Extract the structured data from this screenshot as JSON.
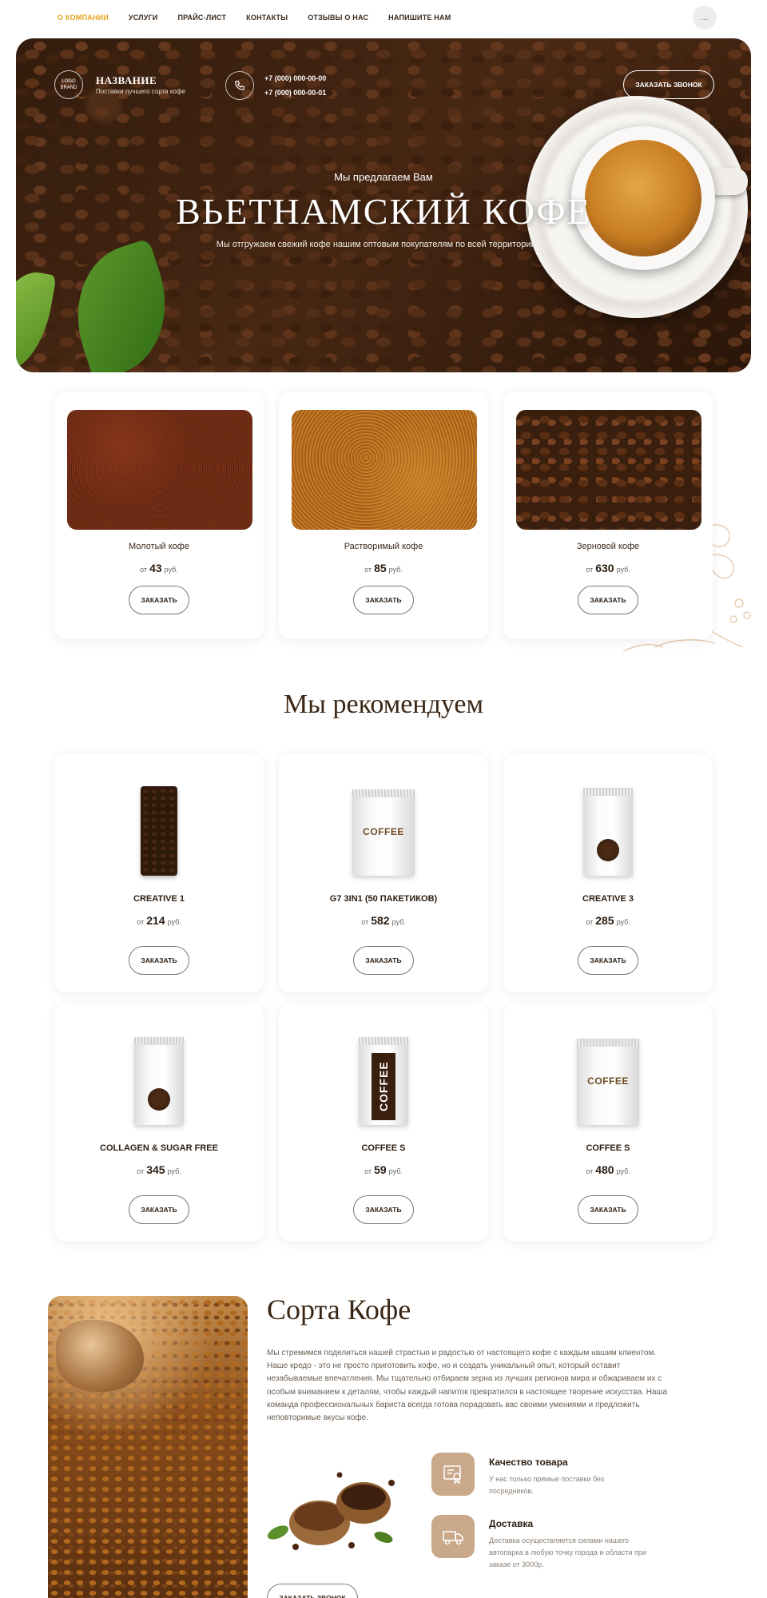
{
  "nav": {
    "links": [
      "О КОМПАНИИ",
      "УСЛУГИ",
      "ПРАЙС-ЛИСТ",
      "КОНТАКТЫ",
      "ОТЗЫВЫ О НАС",
      "НАПИШИТЕ НАМ"
    ],
    "more": "...",
    "accent_color": "#e6a21a"
  },
  "hero": {
    "logo_text": "LOGO BRAND",
    "brand_name": "НАЗВАНИЕ",
    "brand_sub": "Поставки лучшего сорта кофе",
    "phone1": "+7 (000) 000-00-00",
    "phone2": "+7 (000) 000-00-01",
    "callback_button": "ЗАКАЗАТЬ ЗВОНОК",
    "pretitle": "Мы предлагаем Вам",
    "title": "ВЬЕТНАМСКИЙ КОФЕ",
    "subtitle": "Мы отгружаем свежий кофе нашим оптовым покупателям по всей территории РФ"
  },
  "categories": [
    {
      "name": "Молотый кофе",
      "price_from": "от",
      "price": "43",
      "currency": "руб.",
      "button": "ЗАКАЗАТЬ"
    },
    {
      "name": "Растворимый кофе",
      "price_from": "от",
      "price": "85",
      "currency": "руб.",
      "button": "ЗАКАЗАТЬ"
    },
    {
      "name": "Зерновой кофе",
      "price_from": "от",
      "price": "630",
      "currency": "руб.",
      "button": "ЗАКАЗАТЬ"
    }
  ],
  "recommend": {
    "title": "Мы рекомендуем",
    "products": [
      {
        "name": "CREATIVE 1",
        "price_from": "от",
        "price": "214",
        "currency": "руб.",
        "button": "ЗАКАЗАТЬ"
      },
      {
        "name": "G7 3IN1 (50 ПАКЕТИКОВ)",
        "price_from": "от",
        "price": "582",
        "currency": "руб.",
        "button": "ЗАКАЗАТЬ",
        "package_label": "COFFEE"
      },
      {
        "name": "CREATIVE 3",
        "price_from": "от",
        "price": "285",
        "currency": "руб.",
        "button": "ЗАКАЗАТЬ"
      },
      {
        "name": "COLLAGEN & SUGAR FREE",
        "price_from": "от",
        "price": "345",
        "currency": "руб.",
        "button": "ЗАКАЗАТЬ"
      },
      {
        "name": "COFFEE S",
        "price_from": "от",
        "price": "59",
        "currency": "руб.",
        "button": "ЗАКАЗАТЬ",
        "package_label": "COFFEE"
      },
      {
        "name": "COFFEE S",
        "price_from": "от",
        "price": "480",
        "currency": "руб.",
        "button": "ЗАКАЗАТЬ",
        "package_label": "COFFEE"
      }
    ]
  },
  "sorts": {
    "title": "Сорта Кофе",
    "text": "Мы стремимся поделиться нашей страстью и радостью от настоящего кофе с каждым нашим клиентом. Наше кредо - это не просто приготовить кофе, но и создать уникальный опыт, который оставит незабываемые впечатления. Мы тщательно отбираем зерна из лучших регионов мира и обжариваем их с особым вниманием к деталям, чтобы каждый напиток превратился в настоящее творение искусства. Наша команда профессиональных бариста всегда готова порадовать вас своими умениями и предложить неповторимые вкусы кофе.",
    "features": [
      {
        "title": "Качество товара",
        "text": "У нас только прямые поставки без посредников."
      },
      {
        "title": "Доставка",
        "text": "Доставка осуществляется силами нашего автопарка в любую точку города и области при заказе от 3000р."
      }
    ],
    "button": "ЗАКАЗАТЬ ЗВОНОК"
  }
}
